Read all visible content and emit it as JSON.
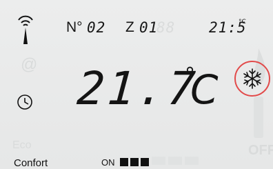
{
  "header": {
    "number_label": "N°",
    "number_value": "02",
    "zone_label": "Z",
    "zone_value": "01",
    "time_value": "21:5",
    "time_unit": "°C"
  },
  "display": {
    "temperature": "21.7",
    "degree": "°",
    "celsius": "C"
  },
  "footer": {
    "mode_label": "Confort",
    "on_label": "ON",
    "level_bars": 3
  },
  "colors": {
    "accent_ring": "#e24a4a",
    "ink": "#141414",
    "background": "#e9eaea"
  },
  "icons": {
    "antenna": "antenna-signal-icon",
    "clock": "clock-icon",
    "snow": "snowflake-icon"
  }
}
